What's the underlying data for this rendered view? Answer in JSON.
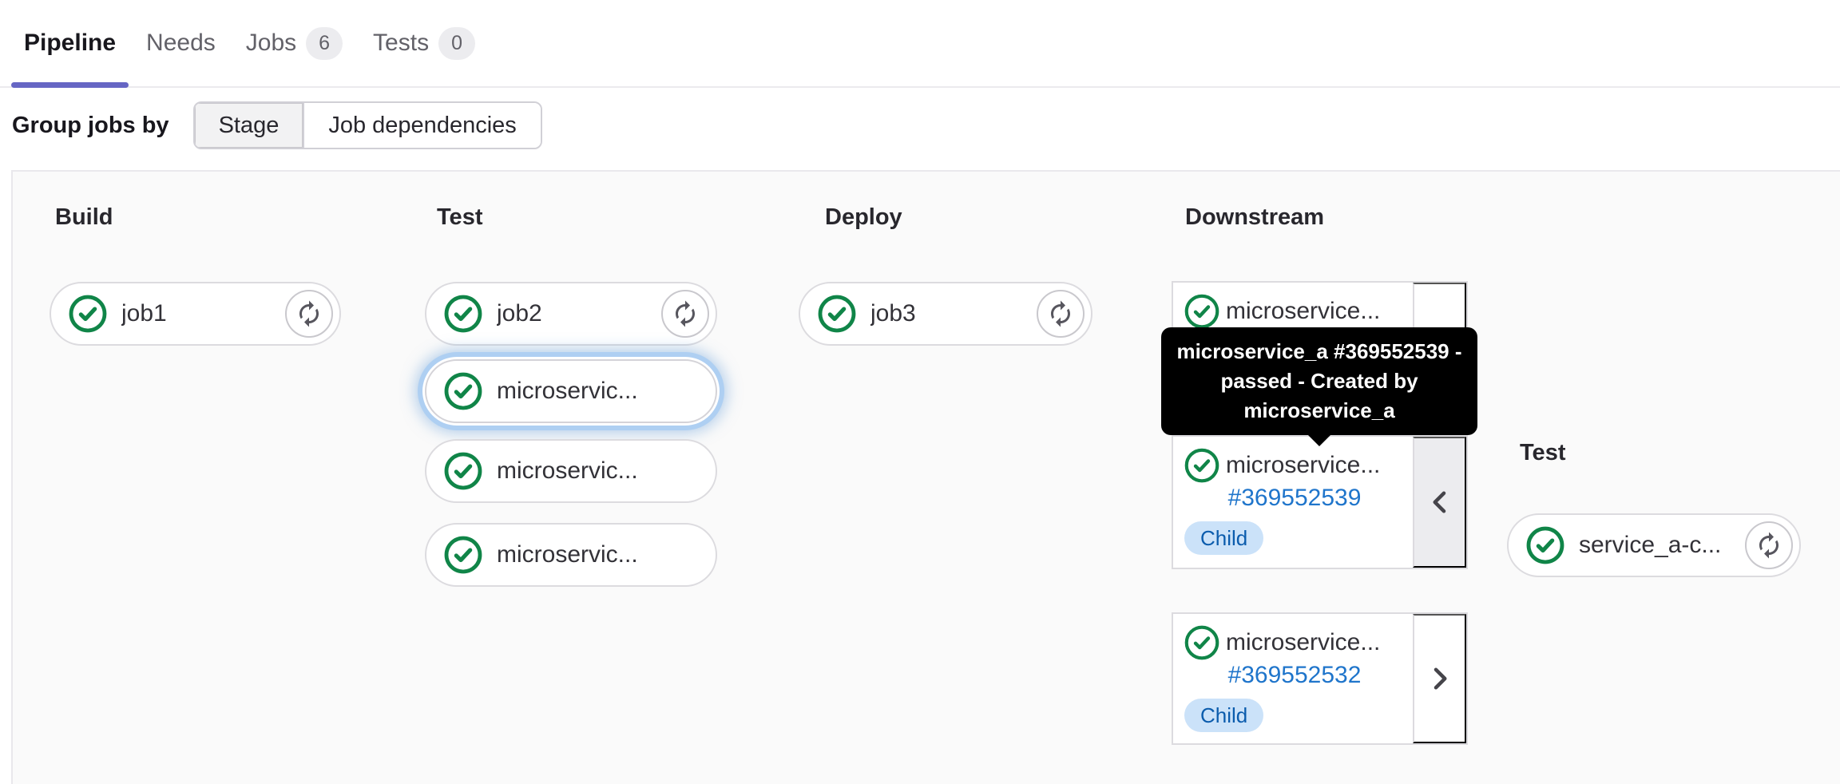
{
  "header": {
    "tabs": {
      "pipeline": "Pipeline",
      "needs": "Needs",
      "jobs": "Jobs",
      "jobs_count": "6",
      "tests": "Tests",
      "tests_count": "0"
    },
    "group_jobs_by_label": "Group jobs by",
    "group_by_options": {
      "stage": "Stage",
      "job_dependencies": "Job dependencies"
    },
    "selected_group_by": "Stage"
  },
  "graph": {
    "stages": {
      "build": {
        "title": "Build",
        "jobs": {
          "job1": {
            "name": "job1",
            "status": "passed"
          }
        }
      },
      "test": {
        "title": "Test",
        "jobs": {
          "job2": {
            "name": "job2",
            "status": "passed"
          },
          "trigger1": {
            "name": "microservic...",
            "status": "passed",
            "focused": true
          },
          "trigger2": {
            "name": "microservic...",
            "status": "passed"
          },
          "trigger3": {
            "name": "microservic...",
            "status": "passed"
          }
        }
      },
      "deploy": {
        "title": "Deploy",
        "jobs": {
          "job3": {
            "name": "job3",
            "status": "passed"
          }
        }
      },
      "downstream": {
        "title": "Downstream",
        "pipelines": {
          "p1": {
            "name": "microservice...",
            "status": "passed"
          },
          "p2": {
            "name": "microservice...",
            "id": "#369552539",
            "badge": "Child",
            "status": "passed",
            "expanded": true
          },
          "p3": {
            "name": "microservice...",
            "id": "#369552532",
            "badge": "Child",
            "status": "passed",
            "expanded": false
          }
        }
      },
      "downstream_test": {
        "title": "Test",
        "jobs": {
          "service": {
            "name": "service_a-c...",
            "status": "passed"
          }
        }
      }
    },
    "tooltip": {
      "line1": "microservice_a #369552539 -",
      "line2": "passed - Created by",
      "line3": "microservice_a"
    }
  },
  "colors": {
    "active_tab_underline": "#6666c4",
    "status_success_green": "#108548",
    "link_blue": "#1f75cb",
    "child_badge_bg": "#cbe2f9",
    "child_badge_text": "#0b5cad",
    "tooltip_bg": "#000000",
    "panel_bg": "#fafafa"
  }
}
